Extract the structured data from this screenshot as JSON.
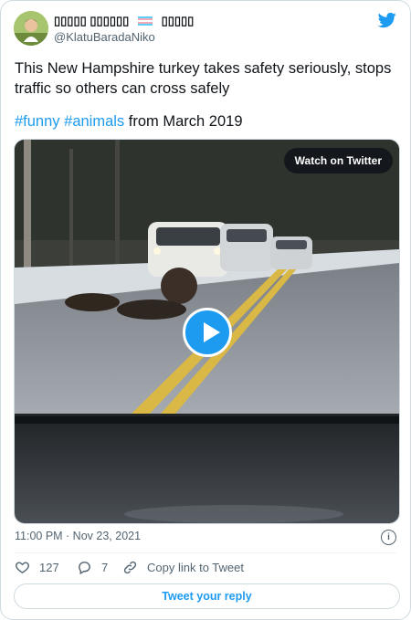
{
  "tweet": {
    "display_name_parts": [
      "▯▯▯▯▯ ▯▯▯▯▯▯",
      "▯▯▯▯▯"
    ],
    "handle": "@KlatuBaradaNiko",
    "text_line": "This New Hampshire turkey takes safety seriously, stops traffic so others can cross safely",
    "hashtags": [
      "#funny",
      "#animals"
    ],
    "text_suffix": "from March 2019",
    "media_label": "Watch on Twitter",
    "timestamp": "11:00 PM · Nov 23, 2021",
    "likes": "127",
    "replies": "7",
    "copy_link": "Copy link to Tweet",
    "reply_button": "Tweet your reply"
  },
  "colors": {
    "accent": "#1d9bf0",
    "text": "#0f1419",
    "muted": "#536471",
    "border": "#cfd9de"
  },
  "icons": [
    "twitter-bird-icon",
    "info-icon",
    "heart-icon",
    "reply-icon",
    "link-icon",
    "play-icon"
  ]
}
